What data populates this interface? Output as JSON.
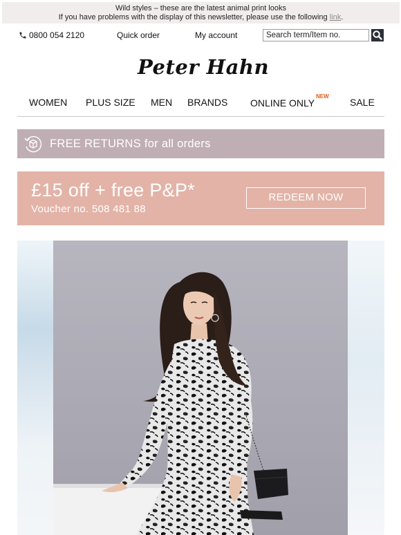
{
  "preheader": {
    "line1": "Wild styles – these are the latest animal print looks",
    "line2_prefix": "If you have problems with the display of this newsletter, please use the following ",
    "link_text": "link",
    "line2_suffix": "."
  },
  "topbar": {
    "phone_icon": "phone-icon",
    "phone": "0800 054 2120",
    "quick_order": "Quick order",
    "my_account": "My account",
    "search_placeholder": "Search term/Item no.",
    "search_icon": "search-icon"
  },
  "logo": "Peter Hahn",
  "nav": {
    "items": [
      "WOMEN",
      "PLUS SIZE",
      "MEN",
      "BRANDS",
      "ONLINE ONLY",
      "SALE"
    ],
    "new_badge": "NEW",
    "new_badge_color": "#e05a1a"
  },
  "returns_banner": {
    "icon": "parcel-return-icon",
    "text": "FREE RETURNS for all orders",
    "bg_color": "#c0aeb5"
  },
  "voucher_banner": {
    "headline": "£15 off + free P&P*",
    "code": "Voucher no. 508 481 88",
    "cta": "REDEEM NOW",
    "bg_color": "#e3b3a7"
  },
  "hero": {
    "subject": "model-in-leopard-print-dress"
  }
}
